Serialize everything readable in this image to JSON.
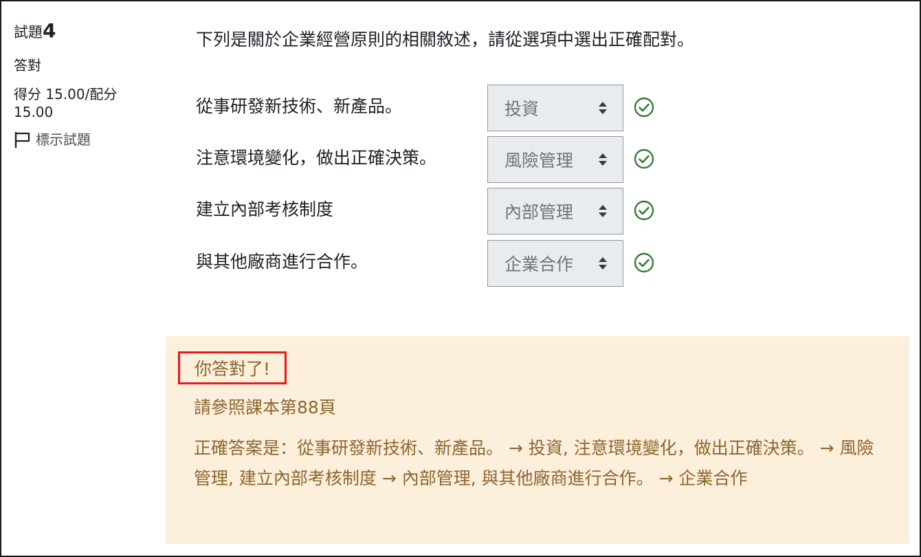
{
  "info": {
    "question_label": "試題",
    "question_number": "4",
    "state": "答對",
    "grade_line1": "得分 15.00/配分",
    "grade_line2": "15.00",
    "flag_label": "標示試題"
  },
  "question": {
    "text": "下列是關於企業經營原則的相關敘述，請從選項中選出正確配對。",
    "rows": [
      {
        "stem": "從事研發新技術、新產品。",
        "selected": "投資"
      },
      {
        "stem": "注意環境變化，做出正確決策。",
        "selected": "風險管理"
      },
      {
        "stem": "建立內部考核制度",
        "selected": "內部管理"
      },
      {
        "stem": "與其他廠商進行合作。",
        "selected": "企業合作"
      }
    ]
  },
  "feedback": {
    "correct_message": "你答對了!",
    "general": "請參照課本第88頁",
    "right_answer": "正確答案是：從事研發新技術、新產品。 → 投資, 注意環境變化，做出正確決策。 → 風險管理, 建立內部考核制度 → 內部管理, 與其他廠商進行合作。 → 企業合作"
  },
  "colors": {
    "correct_icon": "#357a32",
    "feedback_bg": "#fcefdc",
    "feedback_text": "#8e662e",
    "highlight_border": "#e21b1b"
  },
  "icons": {
    "flag": "flag-icon",
    "check": "check-circle-icon",
    "caret": "sort-caret-icon"
  }
}
